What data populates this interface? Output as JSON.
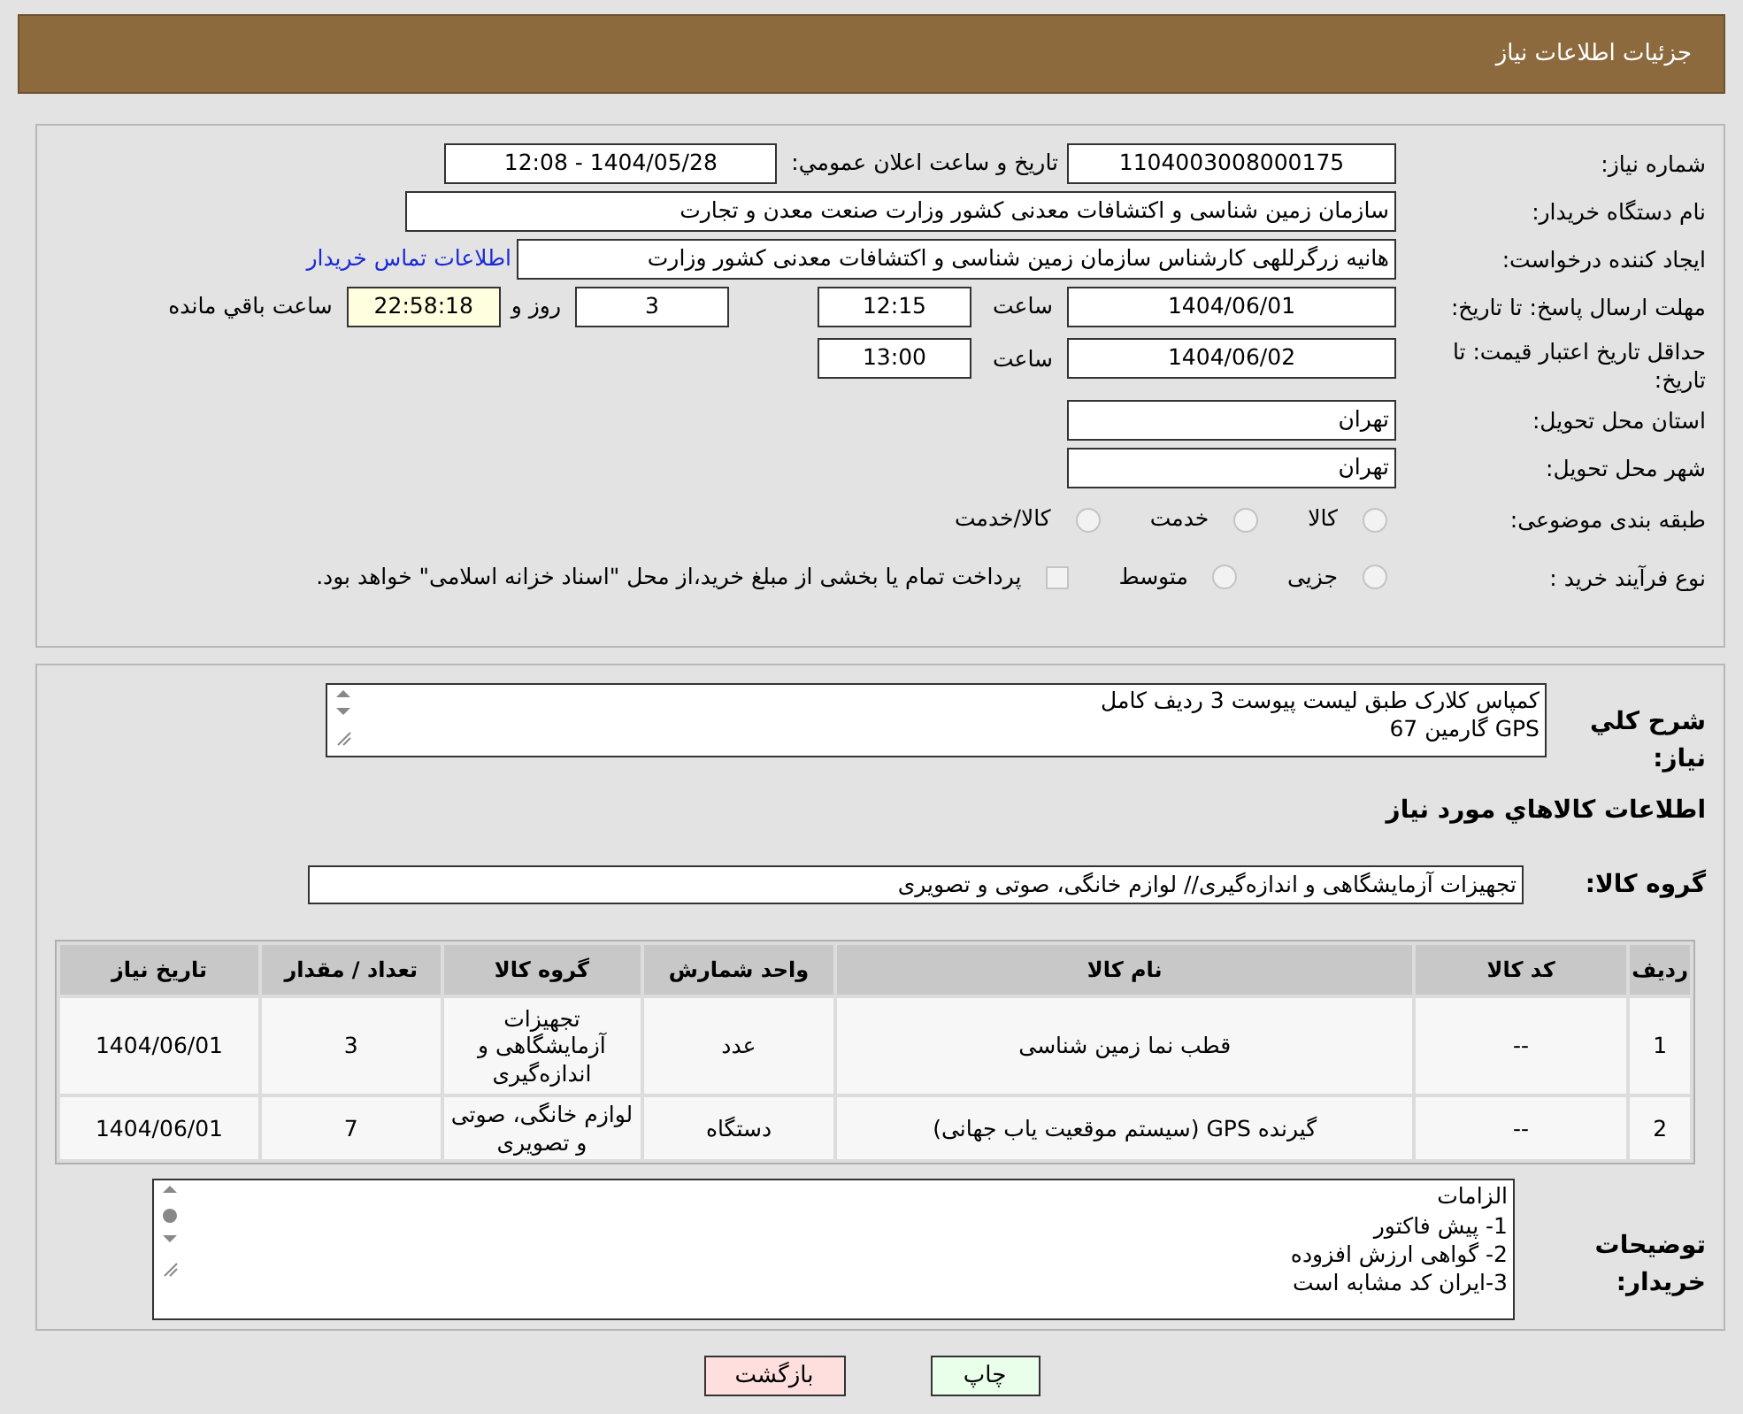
{
  "header": {
    "title": "جزئیات اطلاعات نیاز"
  },
  "need_number": {
    "label": "شماره نیاز:",
    "value": "1104003008000175"
  },
  "announce": {
    "label": "تاریخ و ساعت اعلان عمومي:",
    "value": "1404/05/28 - 12:08"
  },
  "buyer_org": {
    "label": "نام دستگاه خریدار:",
    "value": "سازمان زمین شناسی و اکتشافات معدنی کشور وزارت صنعت معدن و تجارت"
  },
  "creator": {
    "label": "ایجاد کننده درخواست:",
    "value": "هانیه زرگرللهی کارشناس سازمان زمین شناسی و اکتشافات معدنی کشور وزارت",
    "link": "اطلاعات تماس خریدار"
  },
  "deadline": {
    "label": "مهلت ارسال پاسخ: تا تاریخ:",
    "date": "1404/06/01",
    "time_label": "ساعت",
    "time": "12:15",
    "days": "3",
    "days_label": "روز و",
    "remaining": "22:58:18",
    "remaining_label": "ساعت باقي مانده"
  },
  "price_validity": {
    "label": "حداقل تاریخ اعتبار قیمت: تا تاریخ:",
    "date": "1404/06/02",
    "time_label": "ساعت",
    "time": "13:00"
  },
  "province": {
    "label": "استان محل تحویل:",
    "value": "تهران"
  },
  "city": {
    "label": "شهر محل تحویل:",
    "value": "تهران"
  },
  "category": {
    "label": "طبقه بندی موضوعی:",
    "options": [
      {
        "label": "کالا",
        "selected": false
      },
      {
        "label": "خدمت",
        "selected": false
      },
      {
        "label": "کالا/خدمت",
        "selected": false
      }
    ]
  },
  "process": {
    "label": "نوع فرآیند خرید :",
    "options": [
      {
        "label": "جزیی",
        "selected": false
      },
      {
        "label": "متوسط",
        "selected": false
      }
    ],
    "payment": {
      "checked": false,
      "text": "پرداخت تمام یا بخشی از مبلغ خرید،از محل \"اسناد خزانه اسلامی\" خواهد بود."
    }
  },
  "general_description": {
    "label": "شرح کلي نیاز:",
    "lines": [
      "کمپاس کلارک طبق لیست پیوست 3 ردیف کامل",
      "GPS گارمین 67"
    ]
  },
  "goods_info_title": "اطلاعات کالاهاي مورد نیاز",
  "goods_group": {
    "label": "گروه کالا:",
    "value": "تجهیزات آزمایشگاهی و اندازه‌گیری// لوازم خانگی، صوتی و تصویری"
  },
  "table": {
    "columns": [
      "ردیف",
      "کد کالا",
      "نام کالا",
      "واحد شمارش",
      "گروه کالا",
      "تعداد / مقدار",
      "تاریخ نیاز"
    ],
    "rows": [
      [
        "1",
        "--",
        "قطب نما زمین شناسی",
        "عدد",
        "تجهیزات آزمایشگاهی و اندازه‌گیری",
        "3",
        "1404/06/01"
      ],
      [
        "2",
        "--",
        "گیرنده GPS (سیستم موقعیت یاب جهانی)",
        "دستگاه",
        "لوازم خانگی، صوتی و تصویری",
        "7",
        "1404/06/01"
      ]
    ]
  },
  "buyer_notes": {
    "label": "توضیحات خریدار:",
    "lines": [
      "الزامات",
      "1-  پیش فاکتور",
      "2- گواهی ارزش افزوده",
      "3-ایران کد مشابه است"
    ]
  },
  "buttons": [
    {
      "kind": "print",
      "label": "چاپ"
    },
    {
      "kind": "back",
      "label": "بازگشت"
    }
  ]
}
